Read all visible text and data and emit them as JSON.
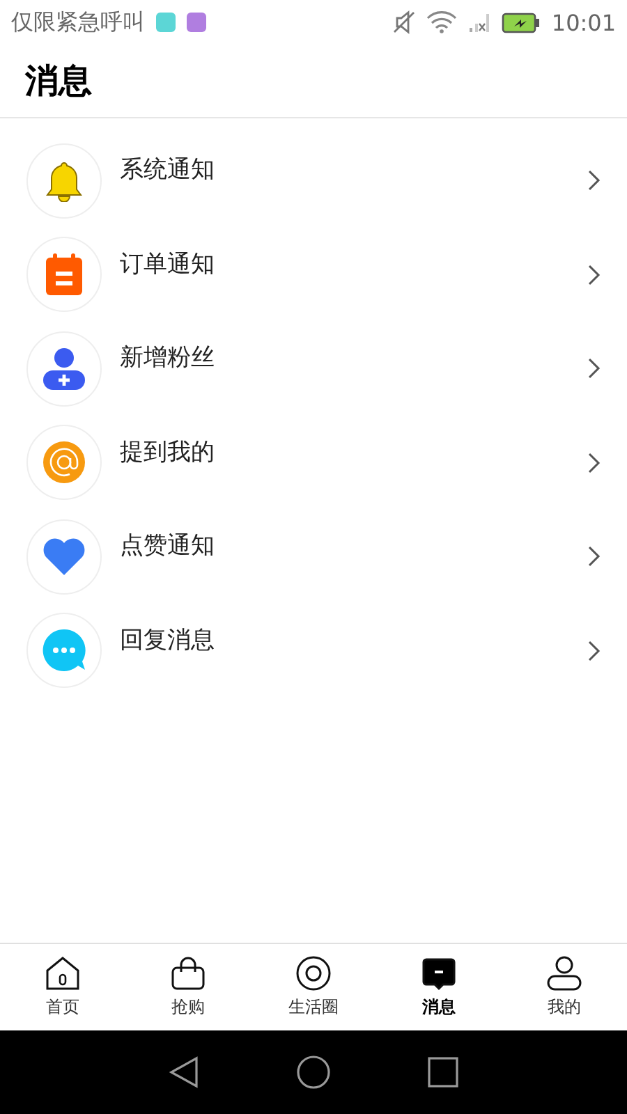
{
  "status_bar": {
    "carrier": "仅限紧急呼叫",
    "time": "10:01"
  },
  "header": {
    "title": "消息"
  },
  "items": [
    {
      "kind": "bell",
      "label": "系统通知"
    },
    {
      "kind": "order",
      "label": "订单通知"
    },
    {
      "kind": "fans",
      "label": "新增粉丝"
    },
    {
      "kind": "mention",
      "label": "提到我的"
    },
    {
      "kind": "like",
      "label": "点赞通知"
    },
    {
      "kind": "reply",
      "label": "回复消息"
    }
  ],
  "tabs": [
    {
      "kind": "home",
      "label": "首页",
      "selected": false
    },
    {
      "kind": "shop",
      "label": "抢购",
      "selected": false
    },
    {
      "kind": "circle",
      "label": "生活圈",
      "selected": false
    },
    {
      "kind": "message",
      "label": "消息",
      "selected": true
    },
    {
      "kind": "me",
      "label": "我的",
      "selected": false
    }
  ]
}
